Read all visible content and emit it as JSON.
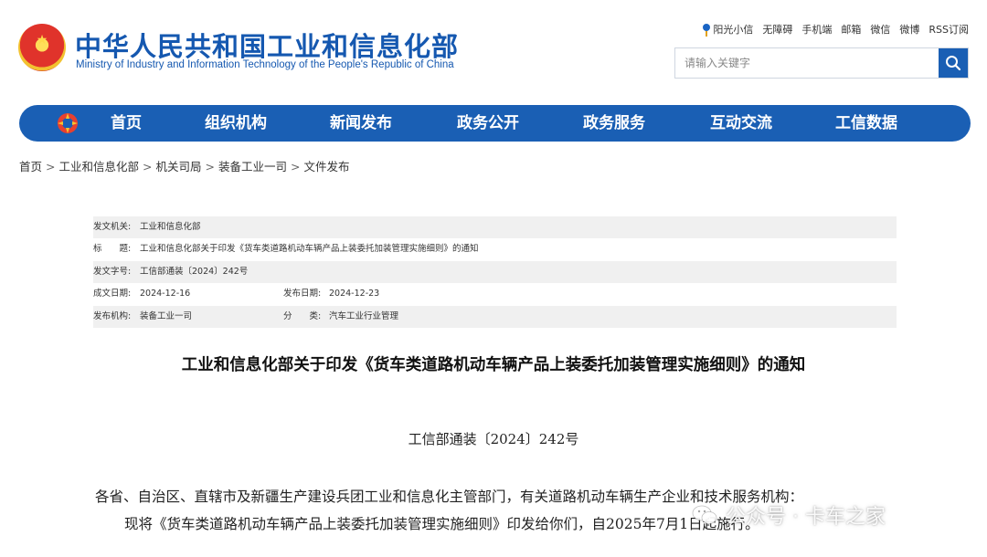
{
  "header": {
    "title": "中华人民共和国工业和信息化部",
    "subtitle": "Ministry of Industry and Information Technology of the People's Republic of China"
  },
  "toplinks": [
    "阳光小信",
    "无障碍",
    "手机端",
    "邮箱",
    "微信",
    "微博",
    "RSS订阅"
  ],
  "search": {
    "placeholder": "请输入关键字"
  },
  "nav": [
    "首页",
    "组织机构",
    "新闻发布",
    "政务公开",
    "政务服务",
    "互动交流",
    "工信数据"
  ],
  "breadcrumb": [
    "首页",
    "工业和信息化部",
    "机关司局",
    "装备工业一司",
    "文件发布"
  ],
  "meta": {
    "issuer_label": "发文机关:",
    "issuer": "工业和信息化部",
    "title_label": "标　　题:",
    "title": "工业和信息化部关于印发《货车类道路机动车辆产品上装委托加装管理实施细则》的通知",
    "docno_label": "发文字号:",
    "docno": "工信部通装〔2024〕242号",
    "created_label": "成文日期:",
    "created": "2024-12-16",
    "published_label": "发布日期:",
    "published": "2024-12-23",
    "org_label": "发布机构:",
    "org": "装备工业一司",
    "category_label": "分　　类:",
    "category": "汽车工业行业管理"
  },
  "article": {
    "title": "工业和信息化部关于印发《货车类道路机动车辆产品上装委托加装管理实施细则》的通知",
    "number": "工信部通装〔2024〕242号",
    "para1": "各省、自治区、直辖市及新疆生产建设兵团工业和信息化主管部门，有关道路机动车辆生产企业和技术服务机构：",
    "para2": "现将《货车类道路机动车辆产品上装委托加装管理实施细则》印发给你们，自2025年7月1日起施行。"
  },
  "watermark": {
    "text": "公众号 · 卡车之家"
  },
  "colors": {
    "brand_blue": "#1a5fb4",
    "title_blue": "#1558b0"
  }
}
